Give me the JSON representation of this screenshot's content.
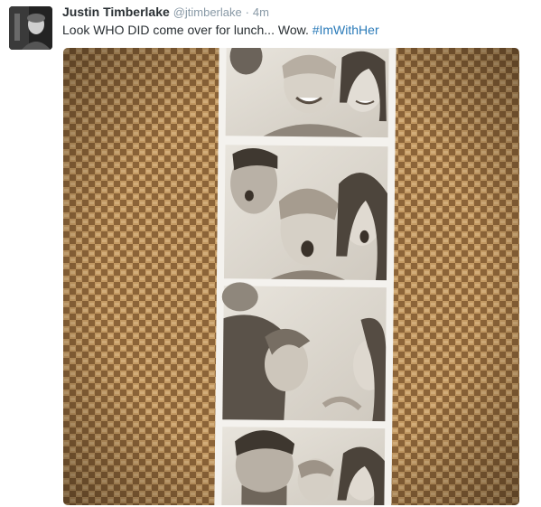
{
  "tweet": {
    "author_name": "Justin Timberlake",
    "handle": "@jtimberlake",
    "separator": "·",
    "time": "4m",
    "text": "Look WHO DID come over for lunch... Wow. ",
    "hashtag": "#ImWithHer"
  },
  "colors": {
    "name": "#292f33",
    "meta": "#8899a6",
    "link": "#2b7bb9",
    "burlap": "#a67c4a"
  },
  "icons": {
    "avatar": "profile-photo",
    "media": "photo-booth-strip-image"
  }
}
